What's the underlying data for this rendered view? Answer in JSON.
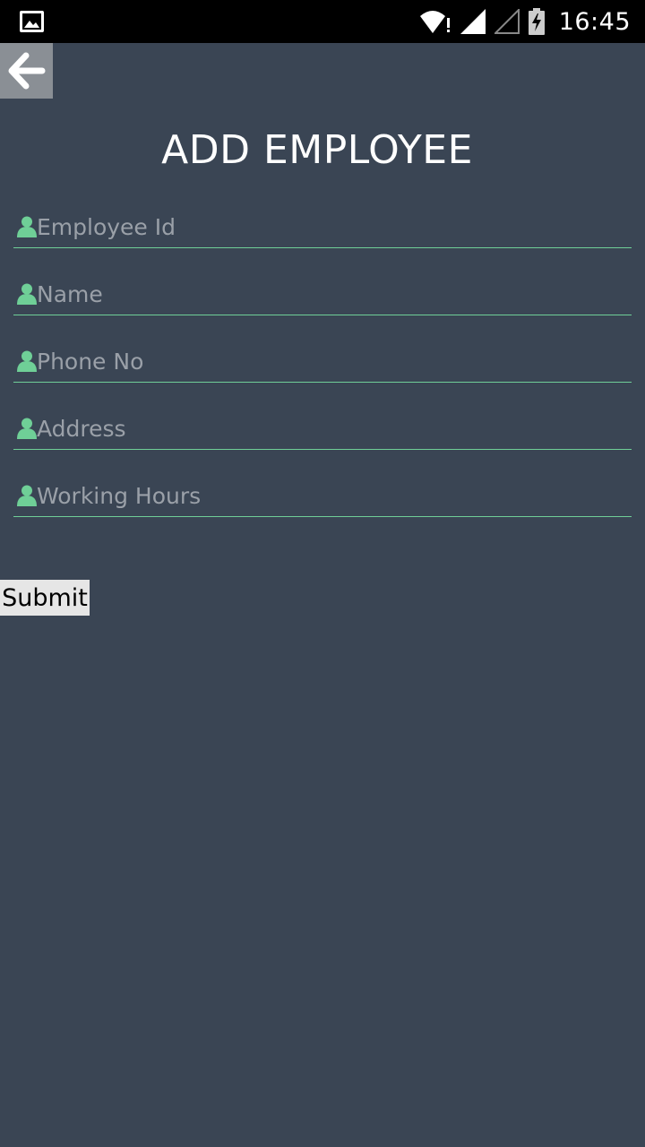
{
  "status_bar": {
    "time": "16:45",
    "icons": [
      "gallery-icon",
      "wifi-alert-icon",
      "signal-icon",
      "signal-empty-icon",
      "battery-charging-icon"
    ]
  },
  "header": {
    "back_icon": "arrow-left-icon",
    "title": "ADD EMPLOYEE"
  },
  "form": {
    "fields": [
      {
        "placeholder": "Employee Id",
        "value": "",
        "icon": "person-icon"
      },
      {
        "placeholder": "Name",
        "value": "",
        "icon": "person-icon"
      },
      {
        "placeholder": "Phone No",
        "value": "",
        "icon": "person-icon"
      },
      {
        "placeholder": "Address",
        "value": "",
        "icon": "person-icon"
      },
      {
        "placeholder": "Working Hours",
        "value": "",
        "icon": "person-icon"
      }
    ],
    "submit_label": "Submit"
  },
  "colors": {
    "background": "#3a4554",
    "accent": "#6fcf97",
    "placeholder": "#9aa0a8",
    "back_button_bg": "#8a8f95"
  }
}
